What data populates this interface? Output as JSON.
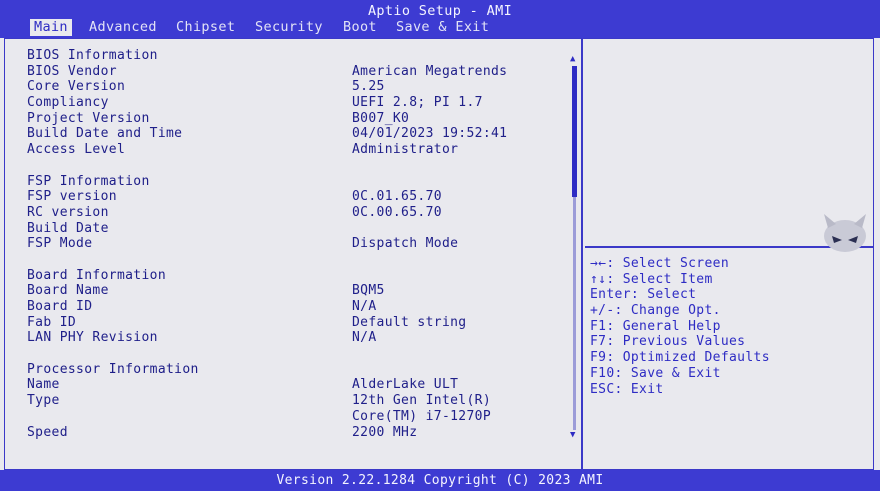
{
  "app": {
    "title": "Aptio Setup - AMI",
    "version_line": "Version 2.22.1284 Copyright (C) 2023 AMI"
  },
  "tabs": [
    {
      "label": "Main",
      "active": true
    },
    {
      "label": "Advanced",
      "active": false
    },
    {
      "label": "Chipset",
      "active": false
    },
    {
      "label": "Security",
      "active": false
    },
    {
      "label": "Boot",
      "active": false
    },
    {
      "label": "Save & Exit",
      "active": false
    }
  ],
  "main": {
    "bios": {
      "heading": "BIOS Information",
      "vendor": {
        "label": "BIOS Vendor",
        "value": "American Megatrends"
      },
      "core_version": {
        "label": "Core Version",
        "value": "5.25"
      },
      "compliancy": {
        "label": "Compliancy",
        "value": "UEFI 2.8; PI 1.7"
      },
      "project_version": {
        "label": "Project Version",
        "value": "B007_K0"
      },
      "build_date_time": {
        "label": "Build Date and Time",
        "value": "04/01/2023 19:52:41"
      },
      "access_level": {
        "label": "Access Level",
        "value": "Administrator"
      }
    },
    "fsp": {
      "heading": "FSP Information",
      "fsp_version": {
        "label": "FSP version",
        "value": "0C.01.65.70"
      },
      "rc_version": {
        "label": "RC version",
        "value": "0C.00.65.70"
      },
      "build_date": {
        "label": "Build Date",
        "value": ""
      },
      "fsp_mode": {
        "label": "FSP Mode",
        "value": "Dispatch Mode"
      }
    },
    "board": {
      "heading": "Board Information",
      "board_name": {
        "label": "Board Name",
        "value": "BQM5"
      },
      "board_id": {
        "label": "Board ID",
        "value": "N/A"
      },
      "fab_id": {
        "label": "Fab ID",
        "value": "Default string"
      },
      "lan_phy": {
        "label": "LAN PHY Revision",
        "value": "N/A"
      }
    },
    "processor": {
      "heading": "Processor Information",
      "name": {
        "label": "Name",
        "value": "AlderLake ULT"
      },
      "type": {
        "label": "Type",
        "value": "12th Gen Intel(R)",
        "value2": "Core(TM) i7-1270P"
      },
      "speed": {
        "label": "Speed",
        "value": "2200 MHz"
      }
    }
  },
  "help": [
    "→←: Select Screen",
    "↑↓: Select Item",
    "Enter: Select",
    "+/-: Change Opt.",
    "F1: General Help",
    "F7: Previous Values",
    "F9: Optimized Defaults",
    "F10: Save & Exit",
    "ESC: Exit"
  ],
  "scrollbar": {
    "position_fraction": 0.0,
    "visible_fraction": 0.36
  },
  "colors": {
    "header_bg": "#3d3bd2",
    "panel_bg": "#e9e9ee",
    "text": "#20208a",
    "accent": "#2e2cc4"
  },
  "icons": {
    "corner_logo": "devil-mascot-icon",
    "scroll_up": "triangle-up-icon",
    "scroll_down": "triangle-down-icon"
  }
}
